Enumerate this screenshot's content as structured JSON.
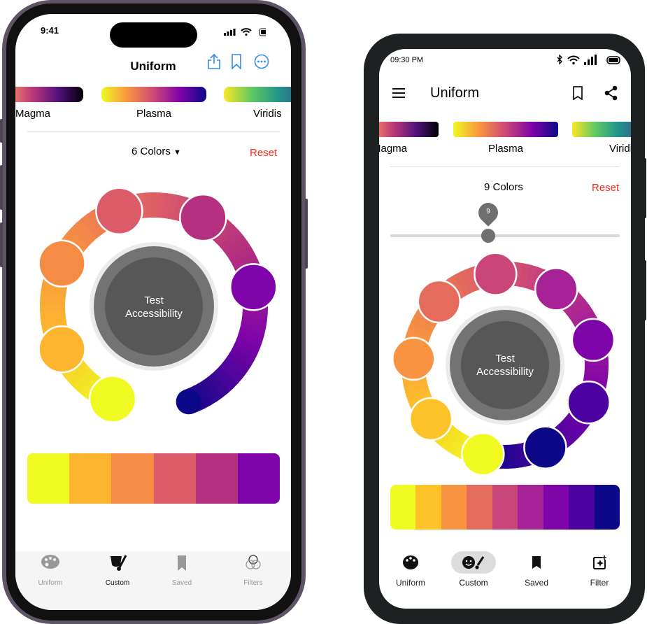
{
  "ios": {
    "status": {
      "time": "9:41"
    },
    "title": "Uniform",
    "palettes": [
      {
        "label": "Magma"
      },
      {
        "label": "Plasma"
      },
      {
        "label": "Viridis"
      }
    ],
    "colors_label": "6 Colors",
    "reset": "Reset",
    "center_button": "Test\nAccessibility",
    "swatches": [
      "#f0f921",
      "#fdb42f",
      "#f58c46",
      "#db5c68",
      "#b5307f",
      "#7e03a8"
    ],
    "ring_end_color": "#0d0887",
    "tabs": [
      {
        "label": "Uniform",
        "icon": "palette-icon",
        "active": false
      },
      {
        "label": "Custom",
        "icon": "theater-brush-icon",
        "active": true
      },
      {
        "label": "Saved",
        "icon": "bookmark-icon",
        "active": false
      },
      {
        "label": "Filters",
        "icon": "filters-icon",
        "active": false
      }
    ],
    "accent": "#2f8cf4",
    "reset_color": "#ff2a1a"
  },
  "android": {
    "status": {
      "time": "09:30 PM"
    },
    "title": "Uniform",
    "palettes": [
      {
        "label": "Magma"
      },
      {
        "label": "Plasma"
      },
      {
        "label": "Viridis"
      }
    ],
    "colors_label": "9 Colors",
    "reset": "Reset",
    "slider": {
      "value": "9"
    },
    "center_button": "Test\nAccessibility",
    "swatches": [
      "#f0f921",
      "#fdc328",
      "#f89441",
      "#e56b5d",
      "#cb4678",
      "#a72197",
      "#7e03a8",
      "#4c02a1",
      "#0d0887"
    ],
    "tabs": [
      {
        "label": "Uniform",
        "icon": "palette-icon",
        "active": false
      },
      {
        "label": "Custom",
        "icon": "face-brush-icon",
        "active": true
      },
      {
        "label": "Saved",
        "icon": "bookmark-icon",
        "active": false
      },
      {
        "label": "Filter",
        "icon": "filter-sparkle-icon",
        "active": false
      }
    ]
  }
}
